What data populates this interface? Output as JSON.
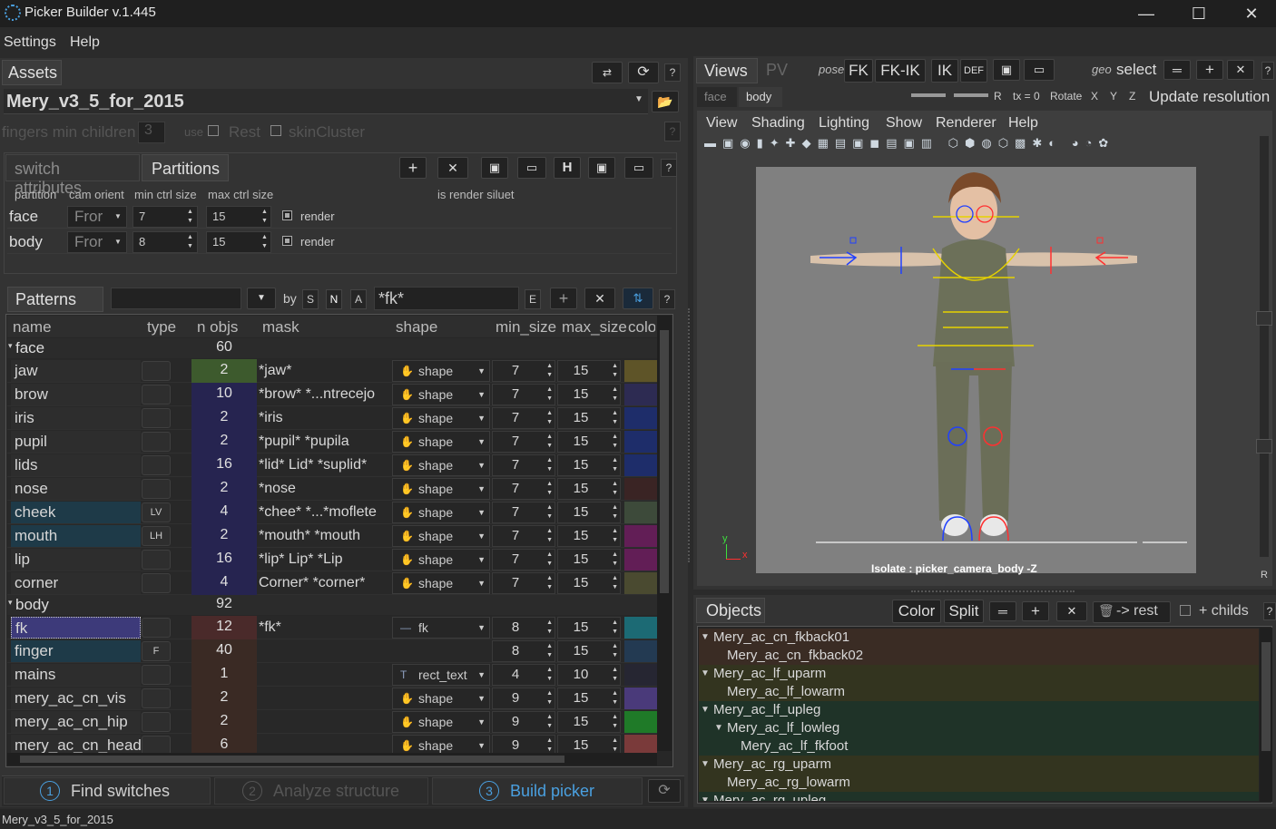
{
  "window": {
    "title": "Picker Builder  v.1.445",
    "minimize": "—",
    "maximize": "☐",
    "close": "✕"
  },
  "menu": [
    "Settings",
    "Help"
  ],
  "assets": {
    "tab": "Assets",
    "asset_name": "Mery_v3_5_for_2015",
    "fingers_label": "fingers min children",
    "fingers_value": "3",
    "use_label": "use",
    "rest_label": "Rest",
    "skin_label": "skinCluster"
  },
  "section_tabs": [
    "switch attributes",
    "Partitions"
  ],
  "partition_headers": [
    "partition",
    "cam orient",
    "min ctrl size",
    "max ctrl size",
    "is render siluet"
  ],
  "partitions": [
    {
      "name": "face",
      "orient": "Fror",
      "min": "7",
      "max": "15",
      "render": "render"
    },
    {
      "name": "body",
      "orient": "Fror",
      "min": "8",
      "max": "15",
      "render": "render"
    }
  ],
  "patterns": {
    "tab": "Patterns",
    "by_label": "by",
    "filter_buttons": [
      "S",
      "N",
      "A"
    ],
    "search": "*fk*",
    "e_button": "E",
    "headers": [
      "name",
      "type",
      "n objs",
      "mask",
      "shape",
      "min_size",
      "max_size",
      "colo"
    ],
    "groups": [
      {
        "name": "face",
        "count": "60"
      },
      {
        "name": "body",
        "count": "92"
      }
    ],
    "rows": [
      {
        "name": "jaw",
        "type": "",
        "n": "2",
        "mask": "*jaw*",
        "shape": "shape",
        "min": "7",
        "max": "15",
        "color": "#5e5428"
      },
      {
        "name": "brow",
        "type": "",
        "n": "10",
        "mask": "*brow* *...ntrecejo",
        "shape": "shape",
        "min": "7",
        "max": "15",
        "color": "#2d2b52"
      },
      {
        "name": "iris",
        "type": "",
        "n": "2",
        "mask": "*iris",
        "shape": "shape",
        "min": "7",
        "max": "15",
        "color": "#1e2d6a"
      },
      {
        "name": "pupil",
        "type": "",
        "n": "2",
        "mask": "*pupil* *pupila",
        "shape": "shape",
        "min": "7",
        "max": "15",
        "color": "#1e2d6a"
      },
      {
        "name": "lids",
        "type": "",
        "n": "16",
        "mask": "*lid* Lid* *suplid*",
        "shape": "shape",
        "min": "7",
        "max": "15",
        "color": "#1e2d6a"
      },
      {
        "name": "nose",
        "type": "",
        "n": "2",
        "mask": "*nose",
        "shape": "shape",
        "min": "7",
        "max": "15",
        "color": "#3a2424"
      },
      {
        "name": "cheek",
        "type": "LV",
        "n": "4",
        "mask": "*chee* *...*moflete",
        "shape": "shape",
        "min": "7",
        "max": "15",
        "color": "#3d4a3a"
      },
      {
        "name": "mouth",
        "type": "LH",
        "n": "2",
        "mask": "*mouth* *mouth",
        "shape": "shape",
        "min": "7",
        "max": "15",
        "color": "#621e56"
      },
      {
        "name": "lip",
        "type": "",
        "n": "16",
        "mask": "*lip* Lip* *Lip",
        "shape": "shape",
        "min": "7",
        "max": "15",
        "color": "#621e56"
      },
      {
        "name": "corner",
        "type": "",
        "n": "4",
        "mask": "Corner* *corner*",
        "shape": "shape",
        "min": "7",
        "max": "15",
        "color": "#4a4a30"
      },
      {
        "name": "fk",
        "type": "",
        "n": "12",
        "mask": "*fk*",
        "shape": "fk",
        "min": "8",
        "max": "15",
        "color": "#1c6a74"
      },
      {
        "name": "finger",
        "type": "F",
        "n": "40",
        "mask": "",
        "shape": "",
        "min": "8",
        "max": "15",
        "color": "#233a52"
      },
      {
        "name": "mains",
        "type": "",
        "n": "1",
        "mask": "",
        "shape": "rect_text",
        "min": "4",
        "max": "10",
        "color": "#262632"
      },
      {
        "name": "mery_ac_cn_vis",
        "type": "",
        "n": "2",
        "mask": "",
        "shape": "shape",
        "min": "9",
        "max": "15",
        "color": "#4a3a7a"
      },
      {
        "name": "mery_ac_cn_hip",
        "type": "",
        "n": "2",
        "mask": "",
        "shape": "shape",
        "min": "9",
        "max": "15",
        "color": "#1f7a28"
      },
      {
        "name": "mery_ac_cn_head",
        "type": "",
        "n": "6",
        "mask": "",
        "shape": "shape",
        "min": "9",
        "max": "15",
        "color": "#7a3a3a"
      }
    ]
  },
  "bottom_steps": [
    {
      "num": "1",
      "label": "Find switches"
    },
    {
      "num": "2",
      "label": "Analyze structure"
    },
    {
      "num": "3",
      "label": "Build picker"
    }
  ],
  "status": "Mery_v3_5_for_2015",
  "views": {
    "tabs": [
      "Views",
      "PV"
    ],
    "pose_label": "pose",
    "pose_buttons": [
      "FK",
      "FK-IK",
      "IK",
      "DEF"
    ],
    "geo_label": "geo",
    "select_label": "select",
    "subtabs": [
      "face",
      "body"
    ],
    "r_label": "R",
    "tx_label": "tx = 0",
    "rotate_label": "Rotate",
    "axes": [
      "X",
      "Y",
      "Z"
    ],
    "update_label": "Update resolution",
    "viewport_menu": [
      "View",
      "Shading",
      "Lighting",
      "Show",
      "Renderer",
      "Help"
    ],
    "isolate_text": "Isolate : picker_camera_body -Z",
    "axis_y": "y",
    "axis_x": "x",
    "r_corner": "R"
  },
  "objects": {
    "tab": "Objects",
    "buttons": [
      "Color",
      "Split"
    ],
    "rest_label": "-> rest",
    "childs_label": "+ childs",
    "items": [
      {
        "label": "Mery_ac_cn_fkback01",
        "level": 0,
        "expander": true,
        "bg": "#3a2c24"
      },
      {
        "label": "Mery_ac_cn_fkback02",
        "level": 1,
        "expander": false,
        "bg": "#3a2c24"
      },
      {
        "label": "Mery_ac_lf_uparm",
        "level": 0,
        "expander": true,
        "bg": "#33341f"
      },
      {
        "label": "Mery_ac_lf_lowarm",
        "level": 1,
        "expander": false,
        "bg": "#33341f"
      },
      {
        "label": "Mery_ac_lf_upleg",
        "level": 0,
        "expander": true,
        "bg": "#1f3328"
      },
      {
        "label": "Mery_ac_lf_lowleg",
        "level": 1,
        "expander": true,
        "bg": "#1f3328"
      },
      {
        "label": "Mery_ac_lf_fkfoot",
        "level": 2,
        "expander": false,
        "bg": "#1f3328"
      },
      {
        "label": "Mery_ac_rg_uparm",
        "level": 0,
        "expander": true,
        "bg": "#33341f"
      },
      {
        "label": "Mery_ac_rg_lowarm",
        "level": 1,
        "expander": false,
        "bg": "#33341f"
      },
      {
        "label": "Mery_ac_rg_upleg",
        "level": 0,
        "expander": true,
        "bg": "#1f3328"
      }
    ]
  },
  "colors": {
    "accent": "#4aa0e0",
    "selection": "#3d3a7a",
    "panel": "#333333"
  }
}
